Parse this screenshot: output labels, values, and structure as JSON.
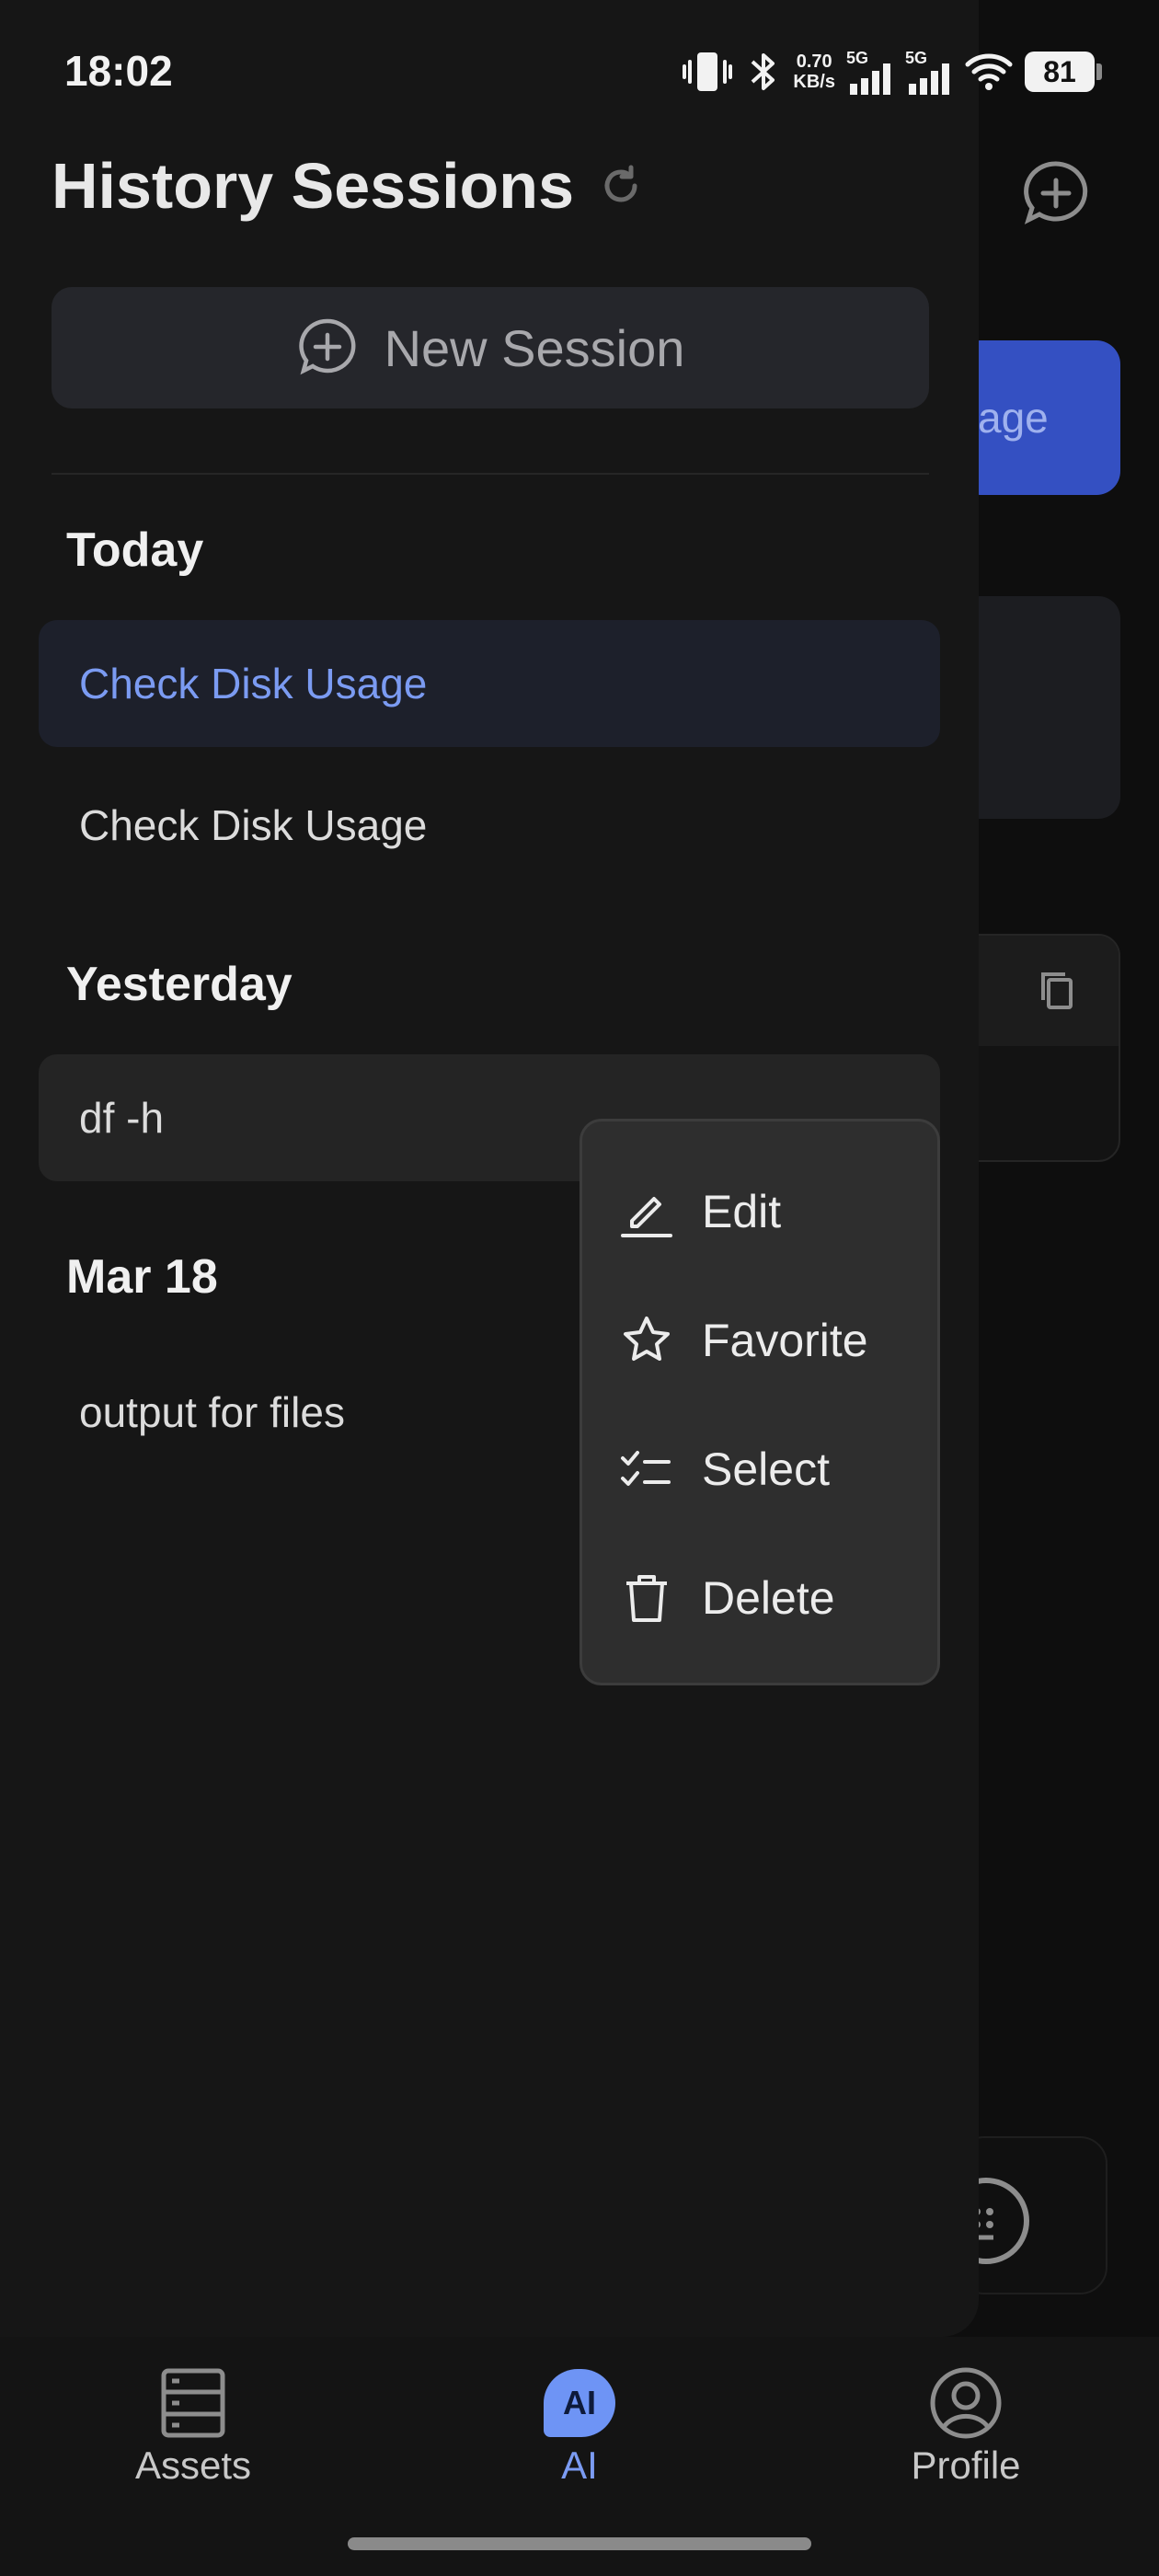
{
  "status_bar": {
    "time": "18:02",
    "net_speed_value": "0.70",
    "net_speed_unit": "KB/s",
    "signal1_label": "5G",
    "signal2_label": "5G",
    "battery": "81"
  },
  "drawer": {
    "title": "History Sessions",
    "new_session_label": "New Session",
    "sections": [
      {
        "heading": "Today",
        "items": [
          "Check Disk Usage",
          "Check Disk Usage"
        ]
      },
      {
        "heading": "Yesterday",
        "items": [
          "df -h"
        ]
      },
      {
        "heading": "Mar 18",
        "items": [
          "output for files"
        ]
      }
    ]
  },
  "context_menu": {
    "edit": "Edit",
    "favorite": "Favorite",
    "select": "Select",
    "delete": "Delete"
  },
  "background": {
    "button_fragment": "sage"
  },
  "bottom_nav": {
    "assets": "Assets",
    "ai": "AI",
    "ai_badge": "AI",
    "profile": "Profile"
  },
  "colors": {
    "accent": "#7b9bf2",
    "drawer_bg": "#161616",
    "menu_bg": "#2e2e2e"
  }
}
